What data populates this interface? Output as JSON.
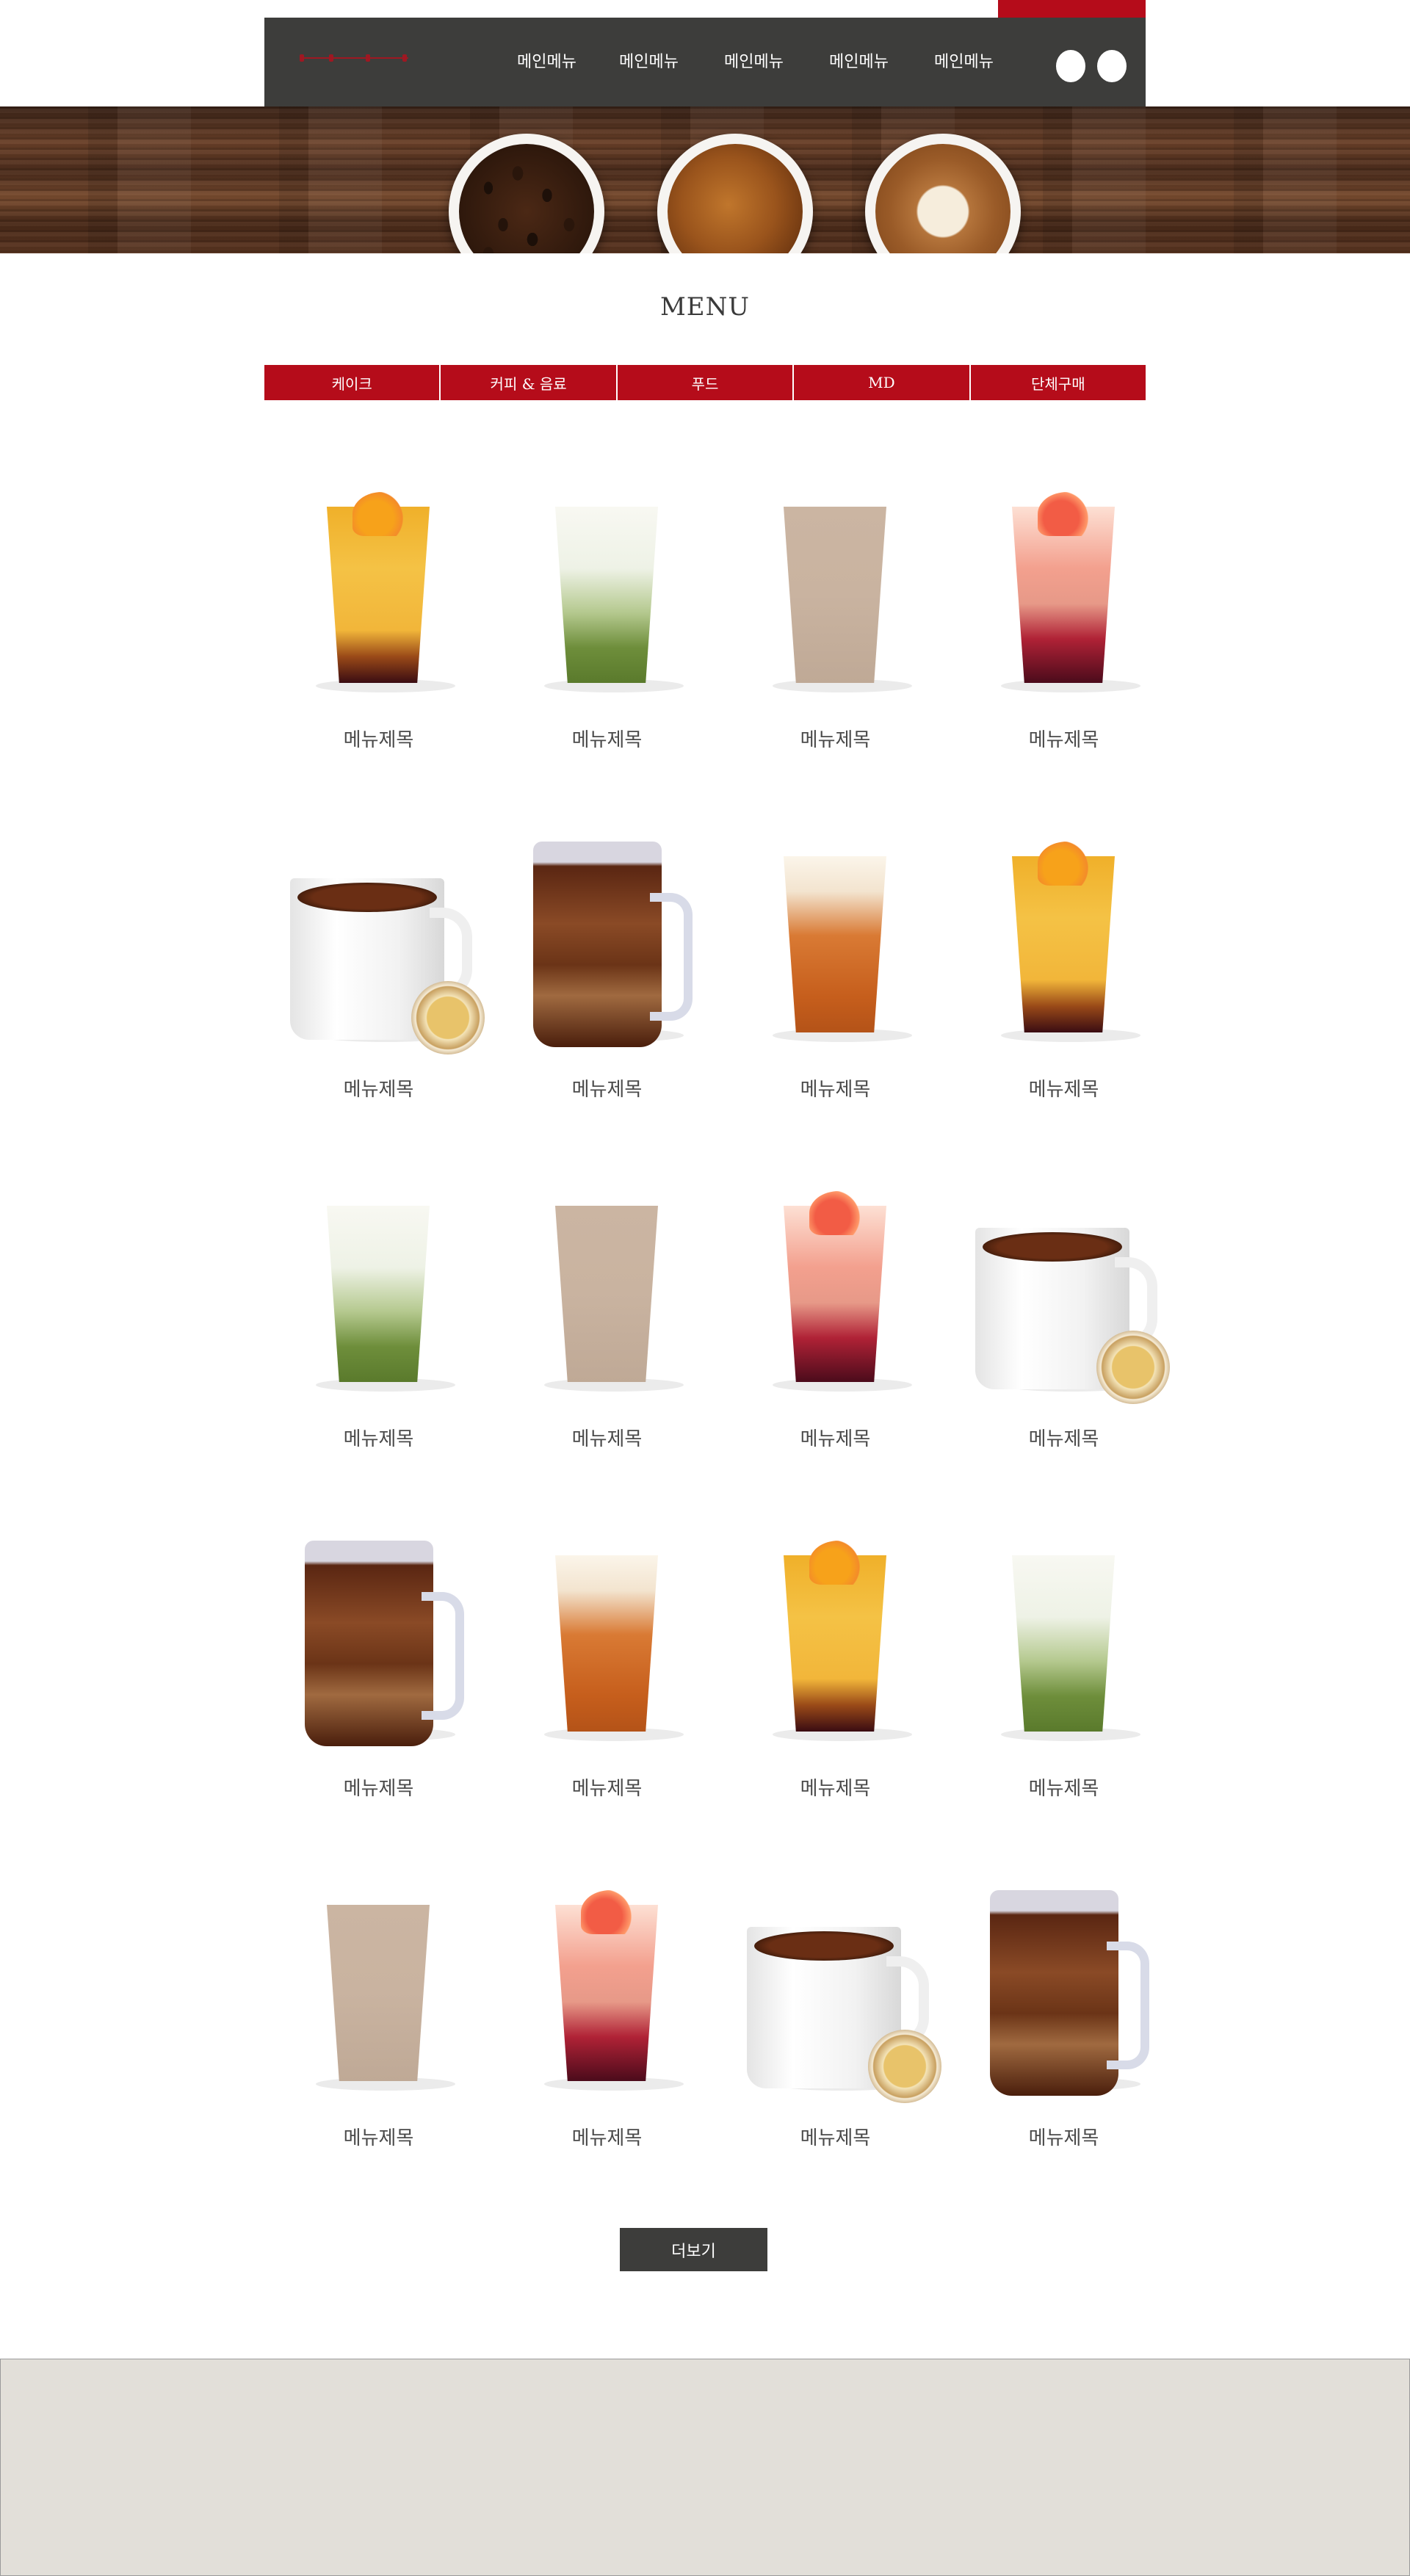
{
  "header": {
    "nav": [
      "메인메뉴",
      "메인메뉴",
      "메인메뉴",
      "메인메뉴",
      "메인메뉴"
    ]
  },
  "banner": {
    "cups": [
      "coffee-beans",
      "espresso",
      "heart-latte"
    ]
  },
  "menu": {
    "title": "MENU",
    "tabs": [
      "케이크",
      "커피 & 음료",
      "푸드",
      "MD",
      "단체구매"
    ]
  },
  "products": [
    {
      "name": "메뉴제목",
      "image": "citrus-tea"
    },
    {
      "name": "메뉴제목",
      "image": "matcha-latte"
    },
    {
      "name": "메뉴제목",
      "image": "frappe"
    },
    {
      "name": "메뉴제목",
      "image": "berry-ade"
    },
    {
      "name": "메뉴제목",
      "image": "hot-tea-mug"
    },
    {
      "name": "메뉴제목",
      "image": "iced-coffee-jar"
    },
    {
      "name": "메뉴제목",
      "image": "cream-tea"
    },
    {
      "name": "메뉴제목",
      "image": "citrus-tea"
    },
    {
      "name": "메뉴제목",
      "image": "matcha-latte"
    },
    {
      "name": "메뉴제목",
      "image": "frappe"
    },
    {
      "name": "메뉴제목",
      "image": "berry-ade"
    },
    {
      "name": "메뉴제목",
      "image": "hot-tea-mug"
    },
    {
      "name": "메뉴제목",
      "image": "iced-coffee-jar"
    },
    {
      "name": "메뉴제목",
      "image": "cream-tea"
    },
    {
      "name": "메뉴제목",
      "image": "citrus-tea"
    },
    {
      "name": "메뉴제목",
      "image": "matcha-latte"
    },
    {
      "name": "메뉴제목",
      "image": "frappe"
    },
    {
      "name": "메뉴제목",
      "image": "berry-ade"
    },
    {
      "name": "메뉴제목",
      "image": "hot-tea-mug"
    },
    {
      "name": "메뉴제목",
      "image": "iced-coffee-jar"
    }
  ],
  "more_button": "더보기",
  "colors": {
    "accent": "#b50c1a",
    "header": "#3d3d3b",
    "footer": "#e2dfd9"
  }
}
